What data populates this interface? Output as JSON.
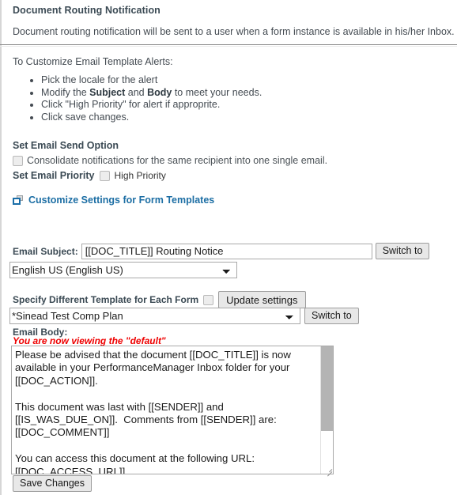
{
  "header": {
    "title": "Document Routing Notification",
    "description": "Document routing notification will be sent to a user when a form instance is available in his/her Inbox."
  },
  "instructions": {
    "lead": "To Customize Email Template Alerts:",
    "items": [
      {
        "pre": "Pick the locale for the alert",
        "bold1": "",
        "mid": "",
        "bold2": "",
        "post": ""
      },
      {
        "pre": "Modify the ",
        "bold1": "Subject",
        "mid": " and ",
        "bold2": "Body",
        "post": " to meet your needs."
      },
      {
        "pre": "Click \"High Priority\" for alert if approprite.",
        "bold1": "",
        "mid": "",
        "bold2": "",
        "post": ""
      },
      {
        "pre": "Click save changes.",
        "bold1": "",
        "mid": "",
        "bold2": "",
        "post": ""
      }
    ]
  },
  "send_option": {
    "group_label": "Set Email Send Option",
    "consolidate_label": "Consolidate notifications for the same recipient into one single email.",
    "consolidate_checked": false,
    "priority_label": "Set Email Priority",
    "high_priority_label": "High Priority",
    "high_priority_checked": false
  },
  "customize_link": {
    "label": "Customize Settings for Form Templates",
    "icon": "popup-window-icon",
    "color": "#1c6ea4"
  },
  "subject": {
    "label": "Email Subject:",
    "value": "[[DOC_TITLE]] Routing Notice",
    "placeholder": "",
    "switch_button": "Switch to"
  },
  "locale": {
    "selected": "English US (English US)",
    "options": [
      "English US (English US)"
    ]
  },
  "per_form": {
    "label": "Specify Different Template for Each Form",
    "checked": false,
    "update_button": "Update settings",
    "template_selected": "*Sinead Test Comp Plan",
    "template_options": [
      "*Sinead Test Comp Plan"
    ],
    "switch_button": "Switch to"
  },
  "body": {
    "label": "Email Body:",
    "viewing_note": "You are now viewing the \"default\"",
    "value": "Please be advised that the document [[DOC_TITLE]] is now available in your PerformanceManager Inbox folder for your [[DOC_ACTION]].\n\nThis document was last with [[SENDER]] and [[IS_WAS_DUE_ON]].  Comments from [[SENDER]] are: [[DOC_COMMENT]]\n\nYou can access this document at the following URL: [[DOC_ACCESS_URL]]",
    "scroll_position": "top"
  },
  "footer": {
    "save_button": "Save Changes"
  },
  "colors": {
    "heading": "#3b4a54",
    "link": "#1c6ea4",
    "alert": "#ee0000",
    "text": "#444b52"
  }
}
